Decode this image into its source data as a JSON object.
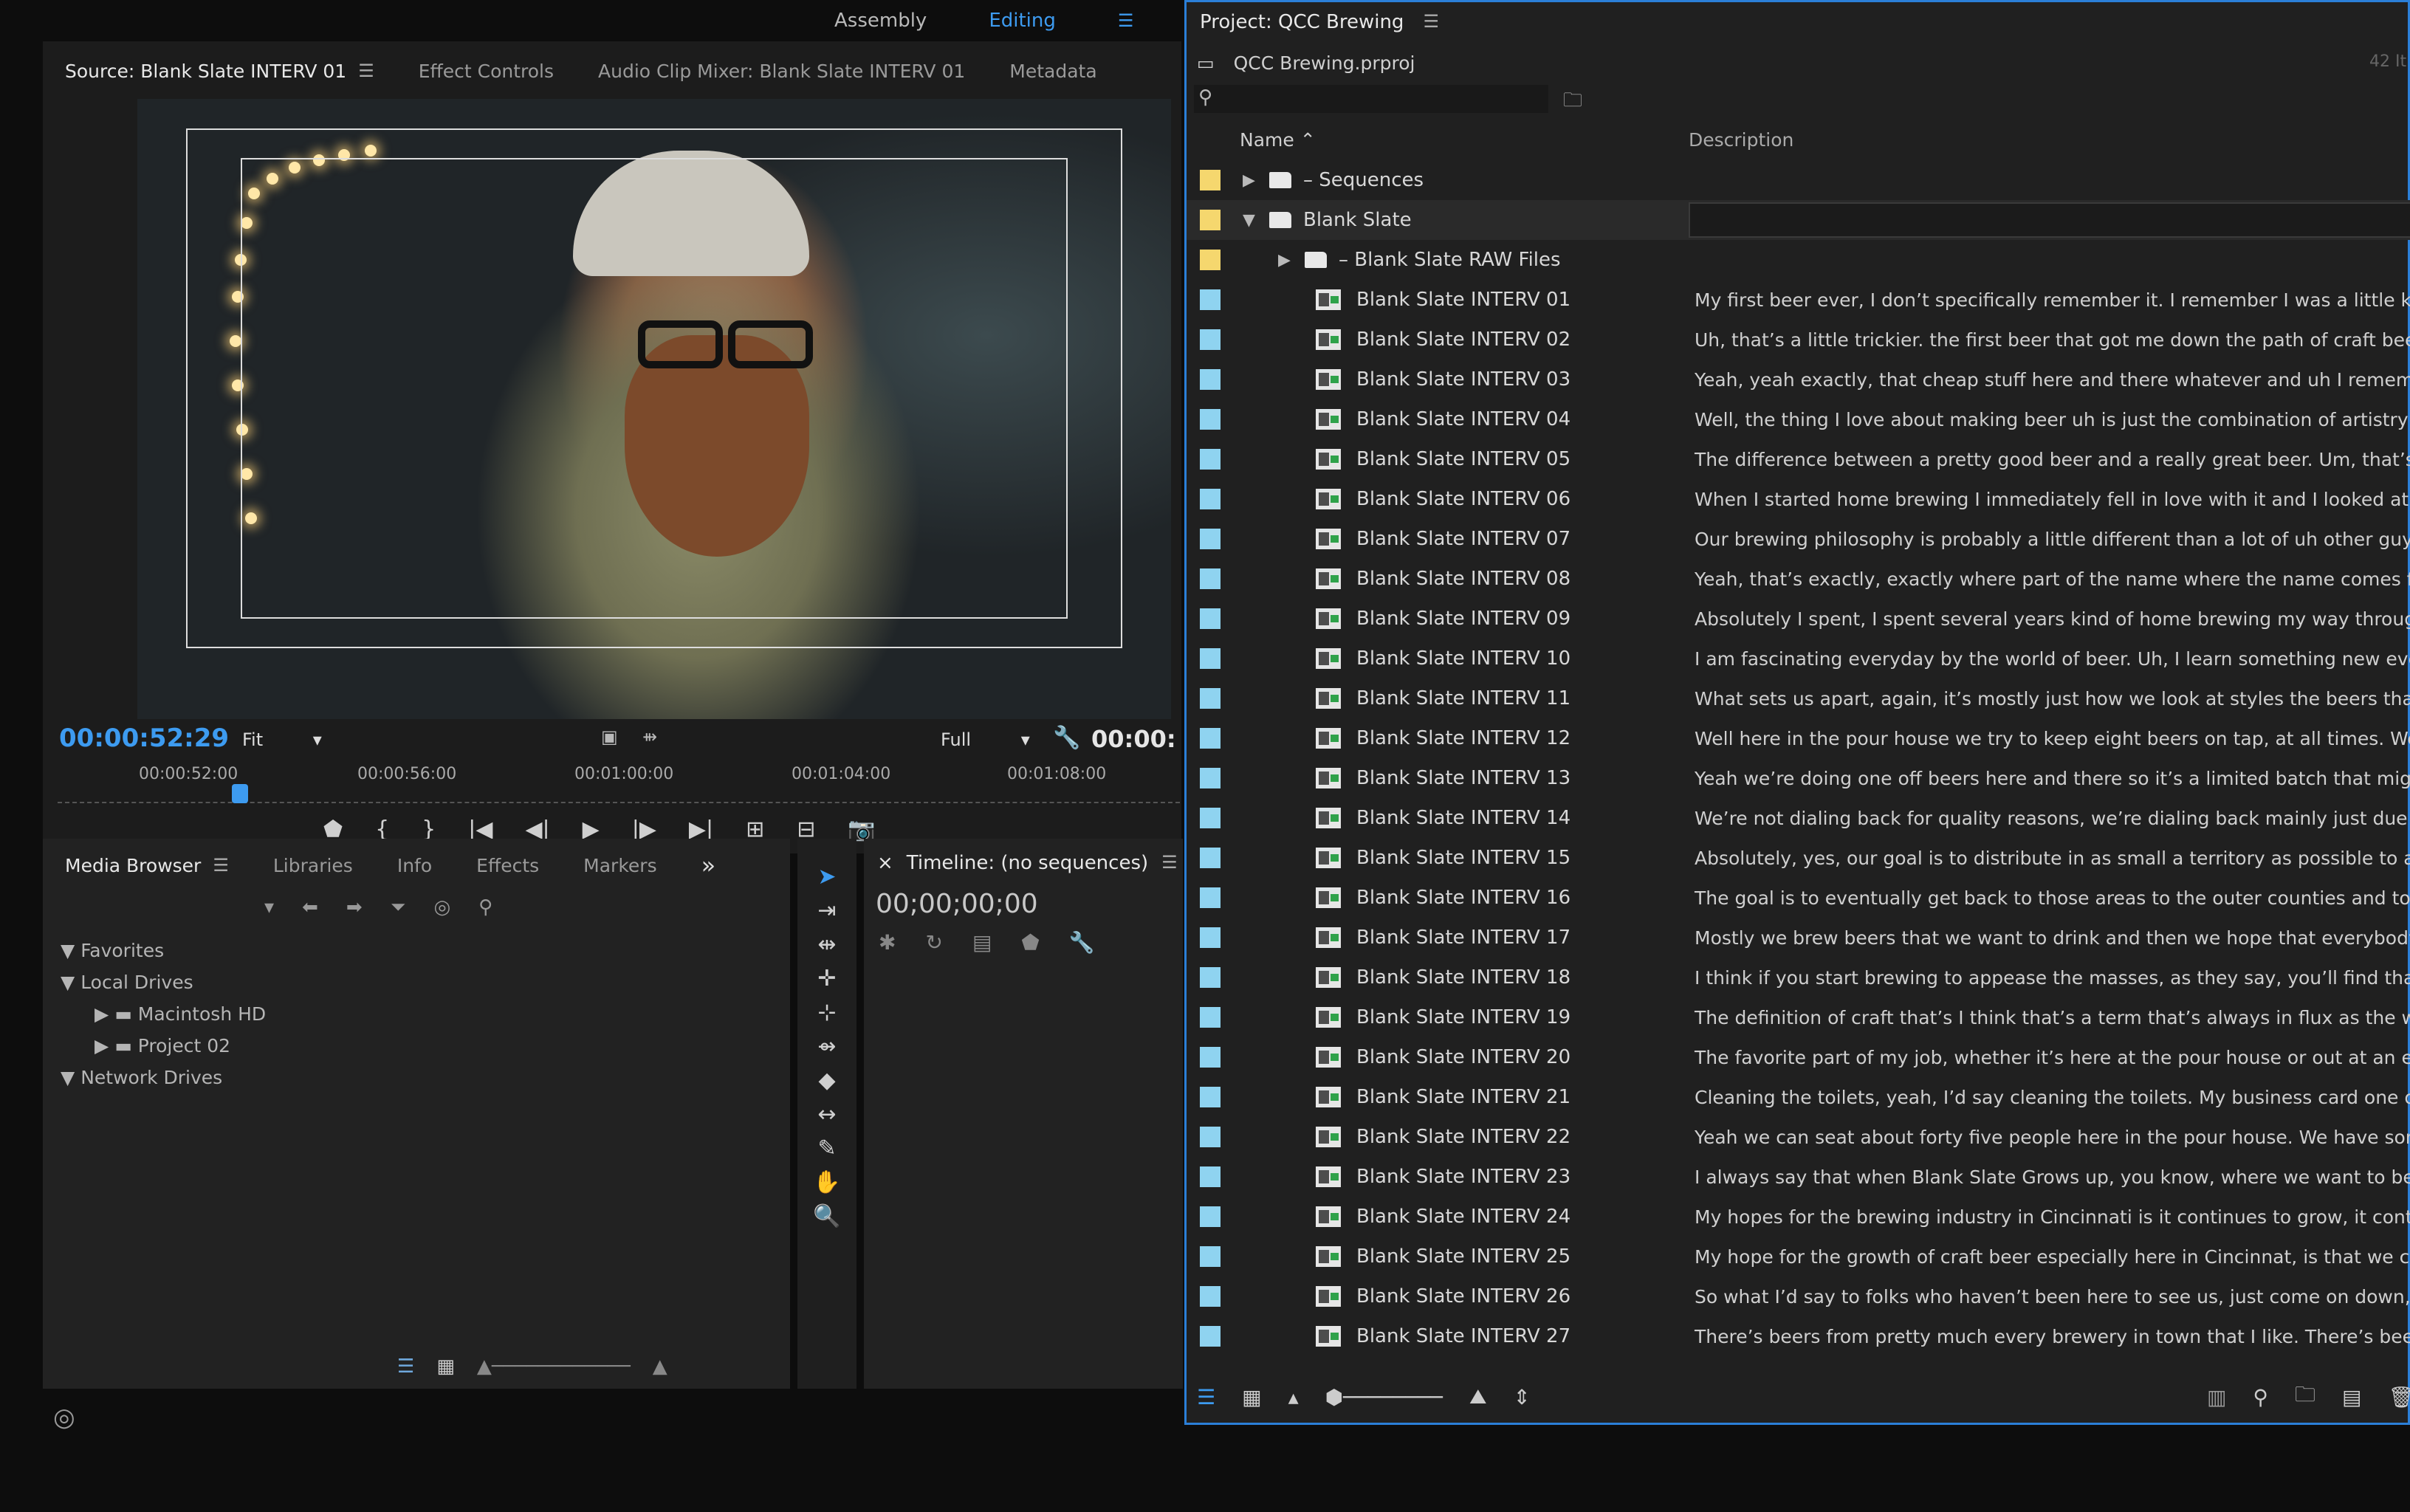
{
  "workspace": {
    "items": [
      "Assembly",
      "Editing"
    ],
    "active": "Editing",
    "menu_icon": "hamburger-icon"
  },
  "source_panel": {
    "tabs": [
      "Source: Blank Slate INTERV 01",
      "Effect Controls",
      "Audio Clip Mixer: Blank Slate INTERV 01",
      "Metadata"
    ],
    "timecode": "00:00:52:29",
    "fit": "Fit",
    "resolution": "Full",
    "duration_partial": "00:00:",
    "ruler": [
      "00:00:52:00",
      "00:00:56:00",
      "00:01:00:00",
      "00:01:04:00",
      "00:01:08:00"
    ],
    "transport_icons": [
      "marker-icon",
      "mark-in-icon",
      "mark-out-icon",
      "go-to-in-icon",
      "step-back-icon",
      "play-icon",
      "step-forward-icon",
      "go-to-out-icon",
      "insert-icon",
      "overwrite-icon",
      "export-frame-icon"
    ]
  },
  "browser_panel": {
    "tabs": [
      "Media Browser",
      "Libraries",
      "Info",
      "Effects",
      "Markers"
    ],
    "more": "»",
    "tree": [
      {
        "label": "Favorites",
        "level": 0,
        "expanded": true
      },
      {
        "label": "Local Drives",
        "level": 0,
        "expanded": true
      },
      {
        "label": "Macintosh HD",
        "level": 1,
        "expanded": false
      },
      {
        "label": "Project 02",
        "level": 1,
        "expanded": false
      },
      {
        "label": "Network Drives",
        "level": 0,
        "expanded": true
      }
    ]
  },
  "tools": [
    "selection-tool-icon",
    "track-select-icon",
    "ripple-edit-icon",
    "rolling-edit-icon",
    "rate-stretch-icon",
    "razor-icon",
    "slip-icon",
    "slide-icon",
    "pen-icon",
    "hand-icon",
    "zoom-icon"
  ],
  "timeline_panel": {
    "title": "Timeline: (no sequences)",
    "close": "×",
    "timecode": "00;00;00;00"
  },
  "project_panel": {
    "title": "Project: QCC Brewing",
    "file": "QCC Brewing.prproj",
    "count": "42 It",
    "columns": {
      "name": "Name",
      "description": "Description"
    },
    "rows": [
      {
        "type": "bin",
        "name": "– Sequences",
        "color": "#f5d76e",
        "indent": 0,
        "expanded": false,
        "desc": ""
      },
      {
        "type": "bin",
        "name": "Blank Slate",
        "color": "#f5d76e",
        "indent": 0,
        "expanded": true,
        "desc": ""
      },
      {
        "type": "bin",
        "name": "– Blank Slate RAW Files",
        "color": "#f5d76e",
        "indent": 1,
        "expanded": false,
        "desc": ""
      },
      {
        "type": "clip",
        "name": "Blank Slate INTERV 01",
        "color": "#8fd3f0",
        "desc": "My first beer ever, I don’t specifically remember it. I remember I was a little kid a"
      },
      {
        "type": "clip",
        "name": "Blank Slate INTERV 02",
        "color": "#8fd3f0",
        "desc": "Uh, that’s a little trickier. the first beer that got me down the path of craft beer w"
      },
      {
        "type": "clip",
        "name": "Blank Slate INTERV 03",
        "color": "#8fd3f0",
        "desc": "Yeah, yeah exactly, that cheap stuff here and there whatever and uh I remember"
      },
      {
        "type": "clip",
        "name": "Blank Slate INTERV 04",
        "color": "#8fd3f0",
        "desc": "Well, the thing I love about making beer uh is just the combination of artistry an"
      },
      {
        "type": "clip",
        "name": "Blank Slate INTERV 05",
        "color": "#8fd3f0",
        "desc": "The difference between a pretty good beer and a really great beer. Um, that’s a t"
      },
      {
        "type": "clip",
        "name": "Blank Slate INTERV 06",
        "color": "#8fd3f0",
        "desc": "When I started home brewing I immediately fell in love with it and I looked at it a"
      },
      {
        "type": "clip",
        "name": "Blank Slate INTERV 07",
        "color": "#8fd3f0",
        "desc": "Our brewing philosophy is probably a little different than a lot of uh other guys c"
      },
      {
        "type": "clip",
        "name": "Blank Slate INTERV 08",
        "color": "#8fd3f0",
        "desc": "Yeah, that’s exactly, exactly where part of the name where the name comes from"
      },
      {
        "type": "clip",
        "name": "Blank Slate INTERV 09",
        "color": "#8fd3f0",
        "desc": "Absolutely I spent, I spent several years kind of home brewing my way through a"
      },
      {
        "type": "clip",
        "name": "Blank Slate INTERV 10",
        "color": "#8fd3f0",
        "desc": "I am fascinating everyday by the world of beer. Uh, I learn something new everyd"
      },
      {
        "type": "clip",
        "name": "Blank Slate INTERV 11",
        "color": "#8fd3f0",
        "desc": "What sets us apart, again, it’s mostly just how we look at styles the beers that w"
      },
      {
        "type": "clip",
        "name": "Blank Slate INTERV 12",
        "color": "#8fd3f0",
        "desc": "Well here in the pour house we try to keep eight beers on tap, at all times. We’re"
      },
      {
        "type": "clip",
        "name": "Blank Slate INTERV 13",
        "color": "#8fd3f0",
        "desc": "Yeah we’re doing one off beers here and there so it’s a limited batch that might"
      },
      {
        "type": "clip",
        "name": "Blank Slate INTERV 14",
        "color": "#8fd3f0",
        "desc": "We’re not dialing back for quality reasons, we’re dialing back mainly just due to"
      },
      {
        "type": "clip",
        "name": "Blank Slate INTERV 15",
        "color": "#8fd3f0",
        "desc": "Absolutely, yes, our goal is to distribute in as small a territory as possible to ach"
      },
      {
        "type": "clip",
        "name": "Blank Slate INTERV 16",
        "color": "#8fd3f0",
        "desc": "The goal is to eventually get back to those areas to the outer counties and to Da"
      },
      {
        "type": "clip",
        "name": "Blank Slate INTERV 17",
        "color": "#8fd3f0",
        "desc": "Mostly we brew beers that we want to drink and then we hope that everybody els"
      },
      {
        "type": "clip",
        "name": "Blank Slate INTERV 18",
        "color": "#8fd3f0",
        "desc": "I think if you start brewing to appease the masses, as they say, you’ll find that th"
      },
      {
        "type": "clip",
        "name": "Blank Slate INTERV 19",
        "color": "#8fd3f0",
        "desc": "The definition of craft that’s I think that’s a term that’s always in flux as the worl"
      },
      {
        "type": "clip",
        "name": "Blank Slate INTERV 20",
        "color": "#8fd3f0",
        "desc": "The favorite part of my job, whether it’s here at the pour house or out at an even"
      },
      {
        "type": "clip",
        "name": "Blank Slate INTERV 21",
        "color": "#8fd3f0",
        "desc": "Cleaning the toilets, yeah, I’d say cleaning the toilets. My business card one of m"
      },
      {
        "type": "clip",
        "name": "Blank Slate INTERV 22",
        "color": "#8fd3f0",
        "desc": "Yeah we can seat about forty five people here in the pour house. We have some"
      },
      {
        "type": "clip",
        "name": "Blank Slate INTERV 23",
        "color": "#8fd3f0",
        "desc": "I always say that when Blank Slate Grows up, you know, where we want to be. Wi"
      },
      {
        "type": "clip",
        "name": "Blank Slate INTERV 24",
        "color": "#8fd3f0",
        "desc": "My hopes for the brewing industry in Cincinnati is it continues to grow, it contin"
      },
      {
        "type": "clip",
        "name": "Blank Slate INTERV 25",
        "color": "#8fd3f0",
        "desc": "My hope for the growth of craft beer especially here in Cincinnat, is that we can j"
      },
      {
        "type": "clip",
        "name": "Blank Slate INTERV 26",
        "color": "#8fd3f0",
        "desc": "So what I’d say to folks who haven’t been here to see us, just come on down, we"
      },
      {
        "type": "clip",
        "name": "Blank Slate INTERV 27",
        "color": "#8fd3f0",
        "desc": "There’s beers from pretty much every brewery in town that I like. There’s beers f"
      }
    ]
  },
  "accent_color": "#3d9bf0"
}
